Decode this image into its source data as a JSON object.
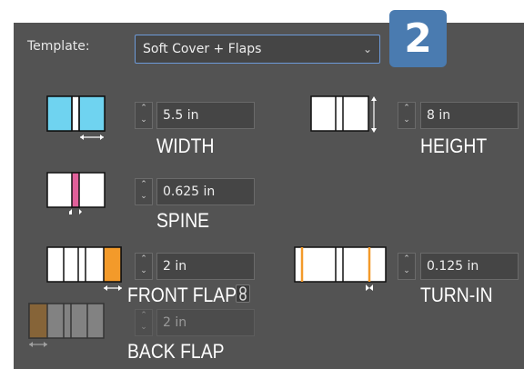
{
  "template": {
    "label": "Template:",
    "value": "Soft Cover + Flaps"
  },
  "step_badge": "2",
  "fields": {
    "width": {
      "value": "5.5 in",
      "caption": "WIDTH"
    },
    "height": {
      "value": "8 in",
      "caption": "HEIGHT"
    },
    "spine": {
      "value": "0.625 in",
      "caption": "SPINE"
    },
    "front_flap": {
      "value": "2 in",
      "caption": "FRONT FLAP"
    },
    "turn_in": {
      "value": "0.125 in",
      "caption": "TURN-IN"
    },
    "back_flap": {
      "value": "2 in",
      "caption": "BACK FLAP",
      "enabled": false
    }
  },
  "icons": {
    "width": "cover-width-icon",
    "height": "cover-height-icon",
    "spine": "spine-icon",
    "front_flap": "front-flap-icon",
    "turn_in": "turn-in-icon",
    "back_flap": "back-flap-icon",
    "link": "link-chain-icon",
    "dropdown": "chevron-down-icon",
    "spinner": "stepper-arrows-icon"
  },
  "colors": {
    "panel": "#535353",
    "badge": "#4a7bb0",
    "width_highlight": "#6fd3f0",
    "spine_highlight": "#e0609a",
    "flap_highlight": "#f39a2a",
    "select_border": "#6d9ad8"
  }
}
